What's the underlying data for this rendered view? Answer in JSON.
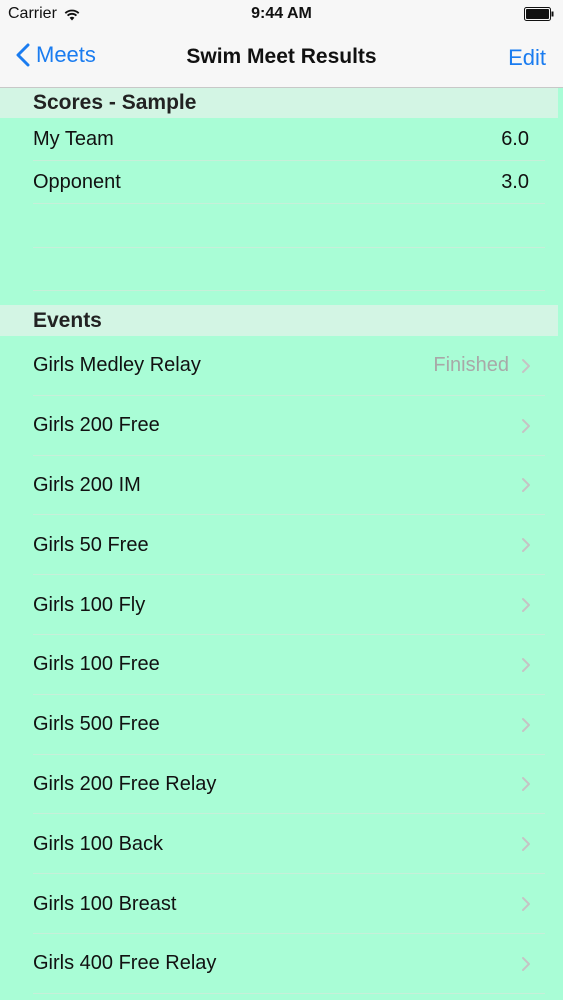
{
  "status_bar": {
    "carrier": "Carrier",
    "time": "9:44 AM"
  },
  "nav": {
    "back_label": "Meets",
    "title": "Swim Meet Results",
    "edit_label": "Edit"
  },
  "scores": {
    "header": "Scores - Sample",
    "rows": [
      {
        "team": "My Team",
        "score": "6.0"
      },
      {
        "team": "Opponent",
        "score": "3.0"
      }
    ]
  },
  "events": {
    "header": "Events",
    "items": [
      {
        "name": "Girls Medley Relay",
        "status": "Finished"
      },
      {
        "name": "Girls 200 Free",
        "status": ""
      },
      {
        "name": "Girls 200 IM",
        "status": ""
      },
      {
        "name": "Girls 50 Free",
        "status": ""
      },
      {
        "name": "Girls 100 Fly",
        "status": ""
      },
      {
        "name": "Girls 100 Free",
        "status": ""
      },
      {
        "name": "Girls 500 Free",
        "status": ""
      },
      {
        "name": "Girls 200 Free Relay",
        "status": ""
      },
      {
        "name": "Girls 100 Back",
        "status": ""
      },
      {
        "name": "Girls 100 Breast",
        "status": ""
      },
      {
        "name": "Girls 400 Free Relay",
        "status": ""
      }
    ]
  },
  "colors": {
    "background": "#a9fdd6",
    "accent": "#1a7cf0",
    "section_header": "#d3f5e4"
  }
}
